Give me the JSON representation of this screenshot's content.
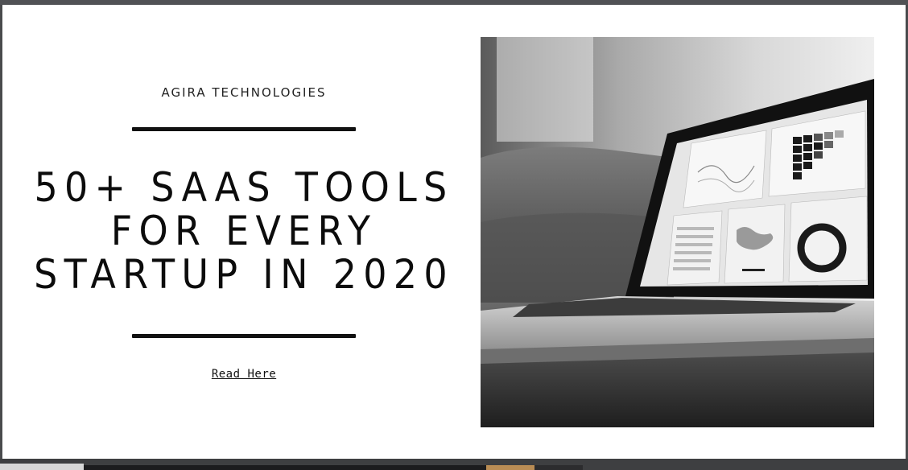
{
  "brand": {
    "name": "AGIRA TECHNOLOGIES"
  },
  "headline": {
    "line1": "50+ SAAS TOOLS",
    "line2": "FOR EVERY",
    "line3": "STARTUP IN 2020"
  },
  "cta": {
    "label": "Read Here"
  },
  "hero_image": {
    "icon": "laptop-dashboard-photo"
  },
  "colors": {
    "text": "#0c0c0c",
    "background": "#ffffff",
    "frame": "#4a4b4d"
  }
}
